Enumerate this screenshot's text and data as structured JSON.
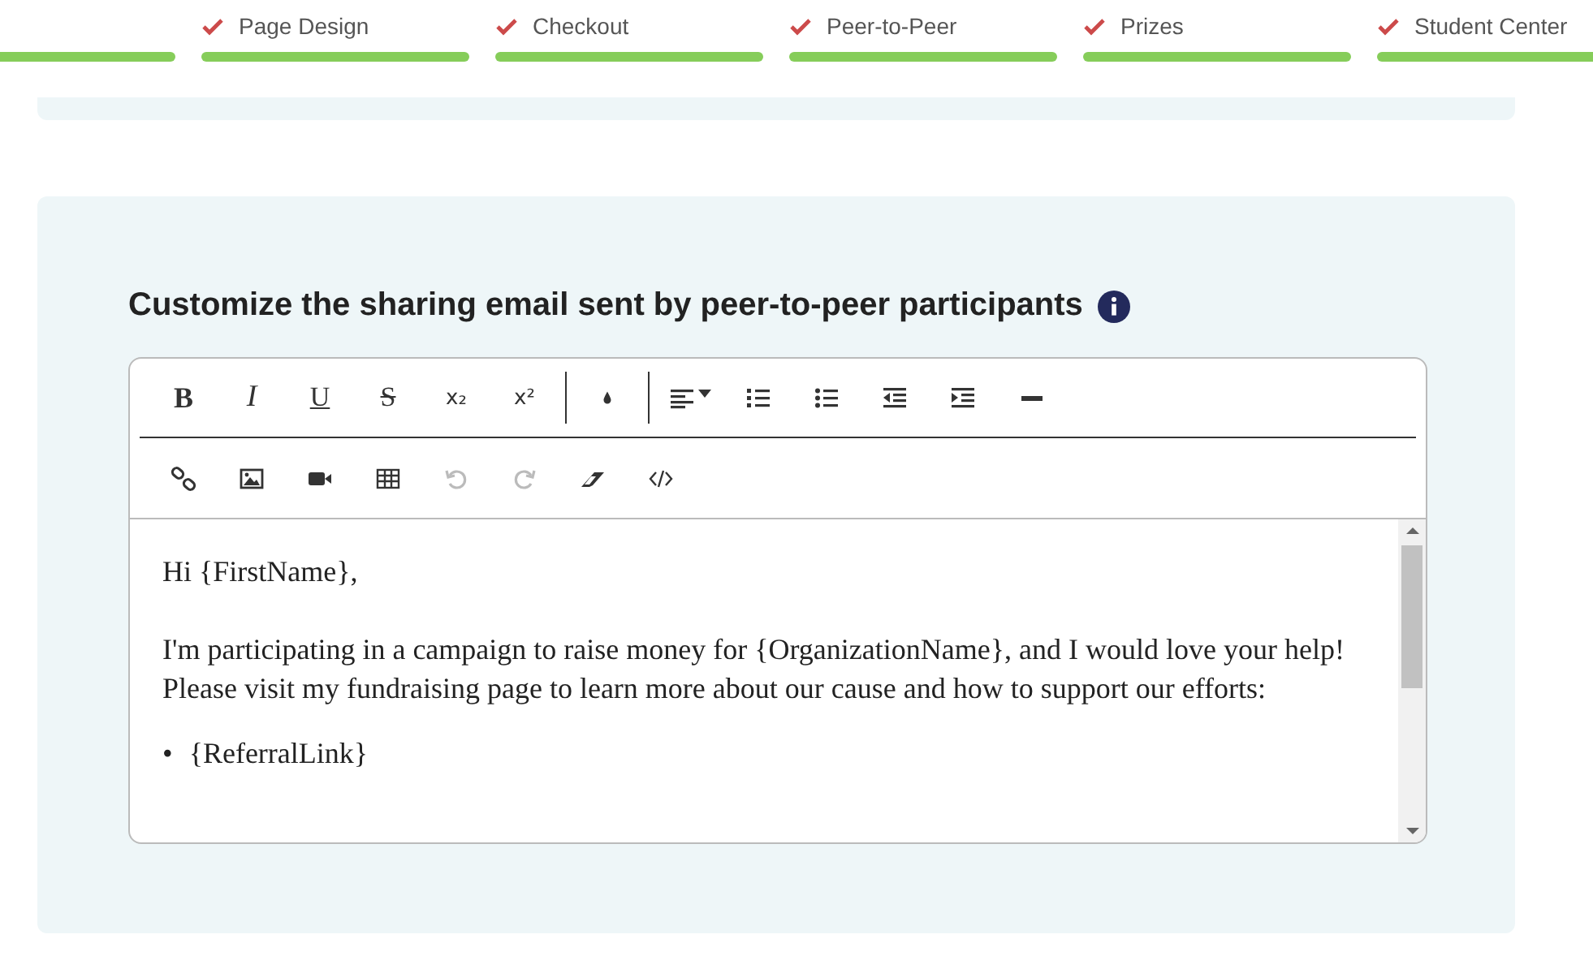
{
  "steps": [
    {
      "completed": true
    },
    {
      "label": "Page Design",
      "completed": true
    },
    {
      "label": "Checkout",
      "completed": true
    },
    {
      "label": "Peer-to-Peer",
      "completed": true
    },
    {
      "label": "Prizes",
      "completed": true
    },
    {
      "label": "Student Center",
      "completed": true
    }
  ],
  "section": {
    "title": "Customize the sharing email sent by peer-to-peer participants"
  },
  "editor": {
    "text_buttons": [
      "B",
      "I",
      "U",
      "S",
      "x₂",
      "x²"
    ],
    "format_buttons": [
      {
        "disabled": false
      },
      {
        "disabled": false
      },
      {
        "disabled": false
      },
      {
        "disabled": false
      },
      {
        "disabled": false
      },
      {
        "disabled": false
      },
      {
        "disabled": false
      }
    ],
    "insert_buttons": [
      {
        "disabled": false
      },
      {
        "disabled": false
      },
      {
        "disabled": false
      },
      {
        "disabled": false
      },
      {
        "disabled": true
      },
      {
        "disabled": true
      },
      {
        "disabled": false
      },
      {
        "disabled": false
      }
    ],
    "greeting": "Hi {FirstName},",
    "paragraph": "I'm participating in a campaign to raise money for {OrganizationName}, and I would love your help!",
    "line": "Please visit my fundraising page to learn more about our cause and how to support our efforts:",
    "bullets": [
      {
        "marker": "•",
        "text": "{ReferralLink}"
      }
    ]
  }
}
